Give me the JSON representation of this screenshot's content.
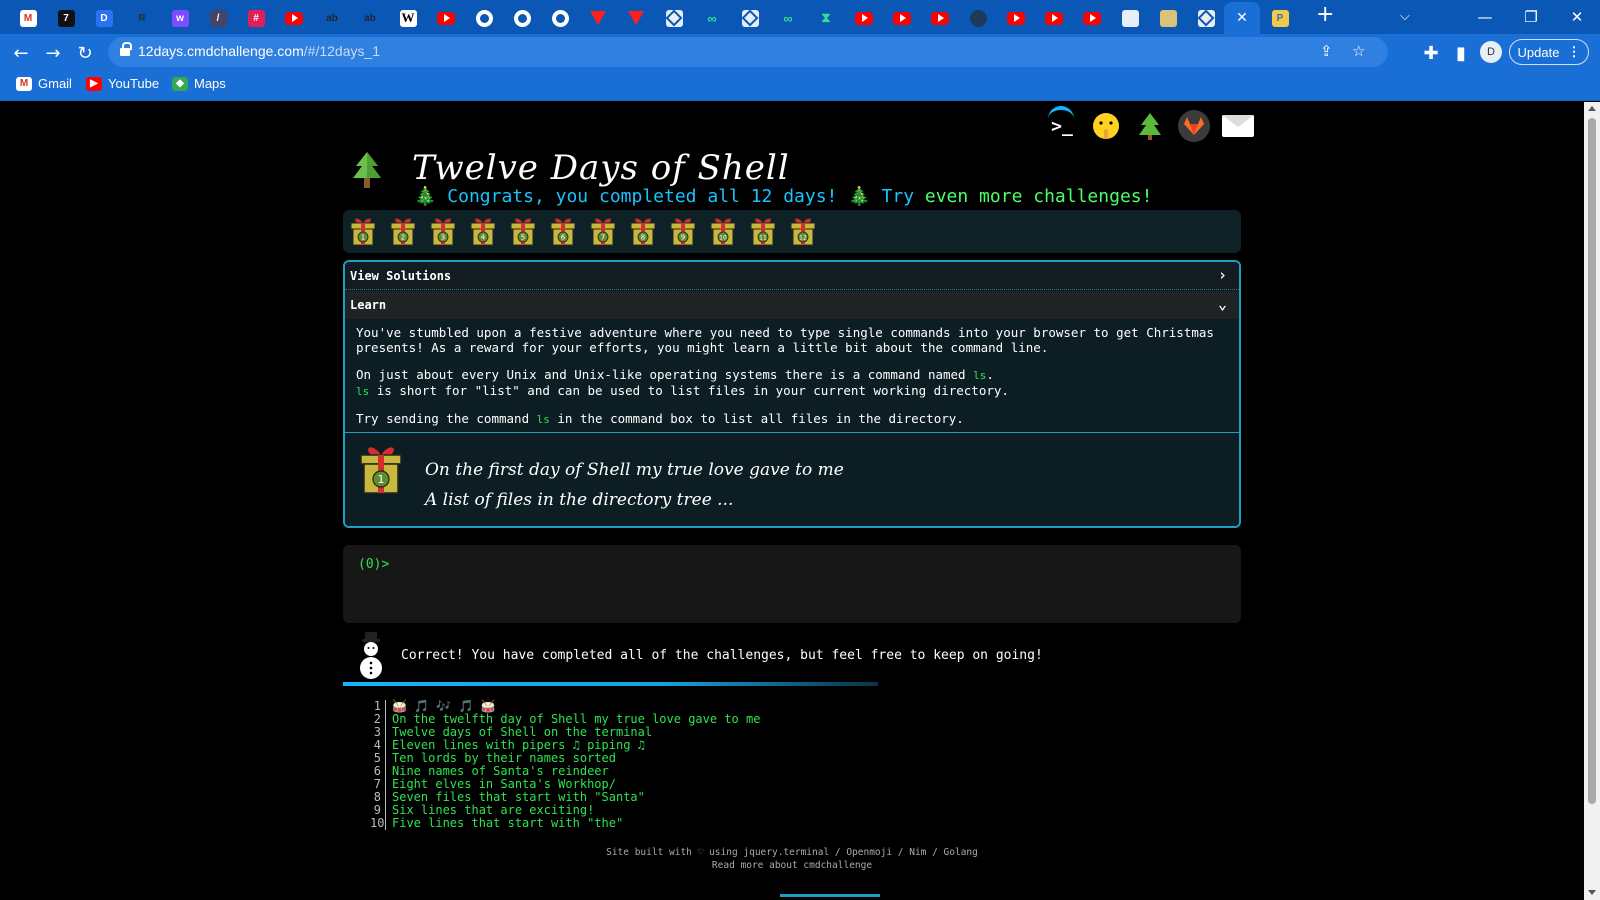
{
  "browser": {
    "url_host": "12days.cmdchallenge.com",
    "url_path": "/#/12days_1",
    "update_label": "Update",
    "profile_initial": "D",
    "bookmarks": [
      {
        "label": "Gmail",
        "icon": "gmail-icon"
      },
      {
        "label": "YouTube",
        "icon": "youtube-icon"
      },
      {
        "label": "Maps",
        "icon": "maps-icon"
      }
    ]
  },
  "page": {
    "title": "Twelve Days of Shell",
    "congrats": "Congrats, you completed all 12 days!",
    "more_link_a": "Try",
    "more_link_b": "even more challenges!",
    "gifts": [
      "1",
      "2",
      "3",
      "4",
      "5",
      "6",
      "7",
      "8",
      "9",
      "10",
      "11",
      "12"
    ],
    "view_solutions_label": "View Solutions",
    "learn_label": "Learn",
    "learn": {
      "p1": "You've stumbled upon a festive adventure where you need to type single commands into your browser to get Christmas presents! As a reward for your efforts, you might learn a little bit about the command line.",
      "p2a": "On just about every Unix and Unix-like operating systems there is a command named",
      "p2_cmd": "ls",
      "p2b_cmd": "ls",
      "p2b": "is short for \"list\" and can be used to list files in your current working directory.",
      "p3a": "Try sending the command",
      "p3_cmd": "ls",
      "p3b": "in the command box to list all files in the directory."
    },
    "poem_line1": "On the first day of Shell my true love gave to me",
    "poem_line2": "A list of files in the directory tree ...",
    "poem_gift_number": "1",
    "prompt": "(0)>",
    "correct_message": "Correct! You have completed all of the challenges, but feel free to keep on going!",
    "solution_lines": [
      {
        "n": "1",
        "text": "🥁 🎵 🎶 🎵 🥁",
        "emoji": true
      },
      {
        "n": "2",
        "text": "On the twelfth day of Shell my true love gave to me"
      },
      {
        "n": "3",
        "text": "Twelve days of Shell on the terminal"
      },
      {
        "n": "4",
        "text": "Eleven lines with pipers ♫ piping ♫"
      },
      {
        "n": "5",
        "text": "Ten lords by their names sorted"
      },
      {
        "n": "6",
        "text": "Nine names of Santa's reindeer"
      },
      {
        "n": "7",
        "text": "Eight elves in Santa's Workhop/"
      },
      {
        "n": "8",
        "text": "Seven files that start with \"Santa\""
      },
      {
        "n": "9",
        "text": "Six lines that are exciting!"
      },
      {
        "n": "10",
        "text": "Five lines that start with \"the\""
      }
    ],
    "footer_line1": "Site built with ♡ using jquery.terminal / Openmoji / Nim / Golang",
    "footer_line2": "Read more about cmdchallenge"
  },
  "colors": {
    "tabstrip": "#0b57b5",
    "toolbar": "#1a6fd6",
    "accent_cyan": "#19c3ff",
    "terminal_green": "#2fe34f",
    "panel_border": "#1d9fc4"
  }
}
